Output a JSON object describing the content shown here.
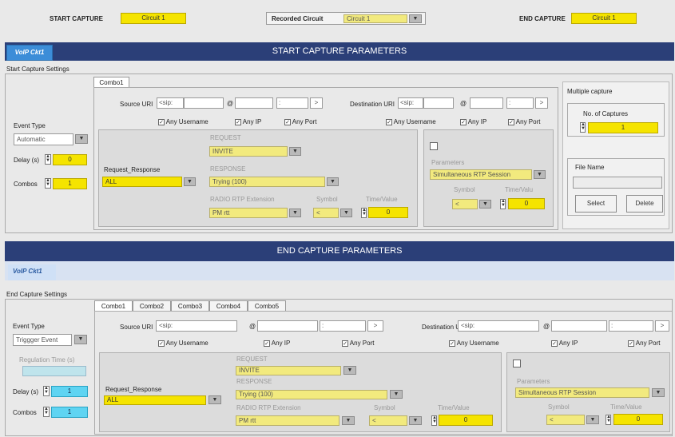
{
  "top": {
    "start_label": "START CAPTURE",
    "start_value": "Circuit 1",
    "rec_label": "Recorded Circuit",
    "rec_value": "Circuit 1",
    "end_label": "END CAPTURE",
    "end_value": "Circuit 1"
  },
  "start": {
    "bar_title": "START CAPTURE PARAMETERS",
    "tab": "VoIP Ckt1",
    "settings_label": "Start Capture Settings",
    "combo_tabs": [
      "Combo1"
    ],
    "source_uri": "Source URI",
    "sip": "<sip:",
    "at": "@",
    ":": ":",
    ">": ">",
    "dest_uri": "Destination URI",
    "any_user": "Any Username",
    "any_ip": "Any IP",
    "any_port": "Any Port",
    "event_type": "Event Type",
    "event_value": "Automatic",
    "delay_label": "Delay (s)",
    "delay_value": "0",
    "combos_label": "Combos",
    "combos_value": "1",
    "rr_label": "Request_Response",
    "rr_value": "ALL",
    "request": "REQUEST",
    "req_value": "INVITE",
    "response": "RESPONSE",
    "resp_value": "Trying (100)",
    "radio": "RADIO RTP Extension",
    "radio_value": "PM rtt",
    "symbol": "Symbol",
    "symbol_value": "<",
    "tv": "Time/Value",
    "tv_value": "0",
    "params": "Parameters",
    "params_value": "Simultaneous RTP Session",
    "p_symbol": "Symbol",
    "p_symbol_value": "<",
    "p_tv": "Time/Valu",
    "p_tv_value": "0",
    "multi": "Multiple capture",
    "noc": "No. of Captures",
    "noc_value": "1",
    "file": "File Name",
    "select": "Select",
    "delete": "Delete"
  },
  "end": {
    "bar_title": "END CAPTURE PARAMETERS",
    "tab": "VoIP Ckt1",
    "settings_label": "End Capture Settings",
    "combo_tabs": [
      "Combo1",
      "Combo2",
      "Combo3",
      "Combo4",
      "Combo5"
    ],
    "source_uri": "Source URI",
    "sip": "<sip:",
    "at": "@",
    ":": ":",
    ">": ">",
    "dest_uri": "Destination URI",
    "any_user": "Any Username",
    "any_ip": "Any IP",
    "any_port": "Any Port",
    "event_type": "Event Type",
    "event_value": "Triggger Event",
    "reg_label": "Regulation Time (s)",
    "delay_label": "Delay (s)",
    "delay_value": "1",
    "combos_label": "Combos",
    "combos_value": "1",
    "rr_label": "Request_Response",
    "rr_value": "ALL",
    "request": "REQUEST",
    "req_value": "INVITE",
    "response": "RESPONSE",
    "resp_value": "Trying (100)",
    "radio": "RADIO RTP Extension",
    "radio_value": "PM rtt",
    "symbol": "Symbol",
    "symbol_value": "<",
    "tv": "Time/Value",
    "tv_value": "0",
    "params": "Parameters",
    "params_value": "Simultaneous RTP Session",
    "p_symbol": "Symbol",
    "p_symbol_value": "<",
    "p_tv": "Time/Value",
    "p_tv_value": "0"
  }
}
